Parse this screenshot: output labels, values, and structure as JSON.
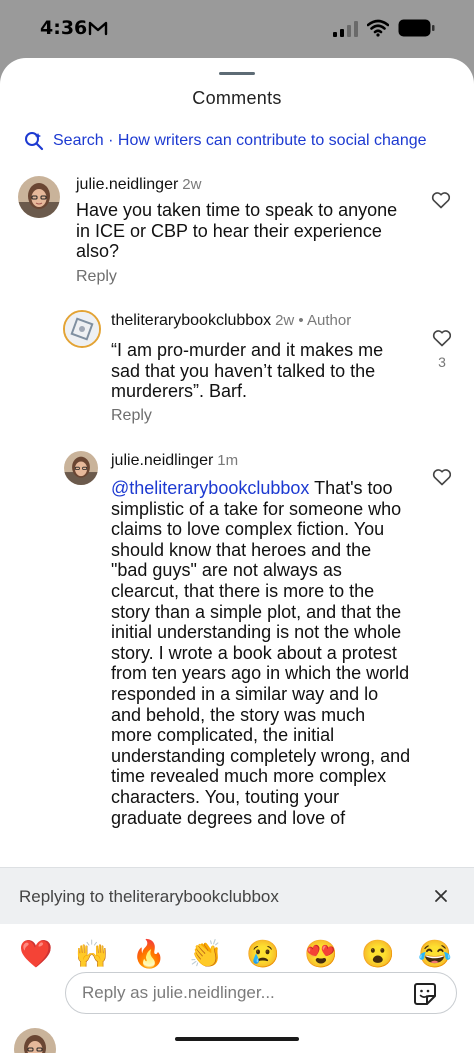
{
  "status_bar": {
    "time": "4:36"
  },
  "header": {
    "title": "Comments"
  },
  "search": {
    "label": "Search · How writers can contribute to social change"
  },
  "comments": [
    {
      "username": "julie.neidlinger",
      "meta": "2w",
      "text": "Have you taken time to speak to anyone in ICE or CBP to hear their experience also?",
      "reply_label": "Reply"
    },
    {
      "username": "theliterarybookclubbox",
      "meta": "2w • Author",
      "text": "“I am pro-murder and it makes me sad that you haven’t talked to the murderers”. Barf.",
      "reply_label": "Reply",
      "likes": "3"
    },
    {
      "username": "julie.neidlinger",
      "meta": "1m",
      "mention": "@theliterarybookclubbox",
      "text": "That's too simplistic of a take for someone who claims to love complex fiction. You should know that heroes and the \"bad guys\" are not always as clearcut, that there is more to the story than a simple plot, and that the initial understanding is not the whole story. I wrote a book about a protest from ten years ago in which the world responded in a similar way and lo and behold, the story was much more complicated, the initial understanding completely wrong, and time revealed much more complex characters. You, touting your graduate degrees and love of"
    }
  ],
  "replying_bar": {
    "text": "Replying to theliterarybookclubbox"
  },
  "emojis": [
    "❤️",
    "🙌",
    "🔥",
    "👏",
    "😢",
    "😍",
    "😮",
    "😂"
  ],
  "composer": {
    "placeholder": "Reply as julie.neidlinger..."
  },
  "colors": {
    "link": "#1d3ad1",
    "sheet": "#ffffff",
    "backdrop": "#9a9a9a"
  },
  "icons": [
    "mail-icon",
    "signal-icon",
    "wifi-icon",
    "battery-icon",
    "search-icon",
    "heart-icon",
    "close-icon",
    "sticker-icon"
  ]
}
